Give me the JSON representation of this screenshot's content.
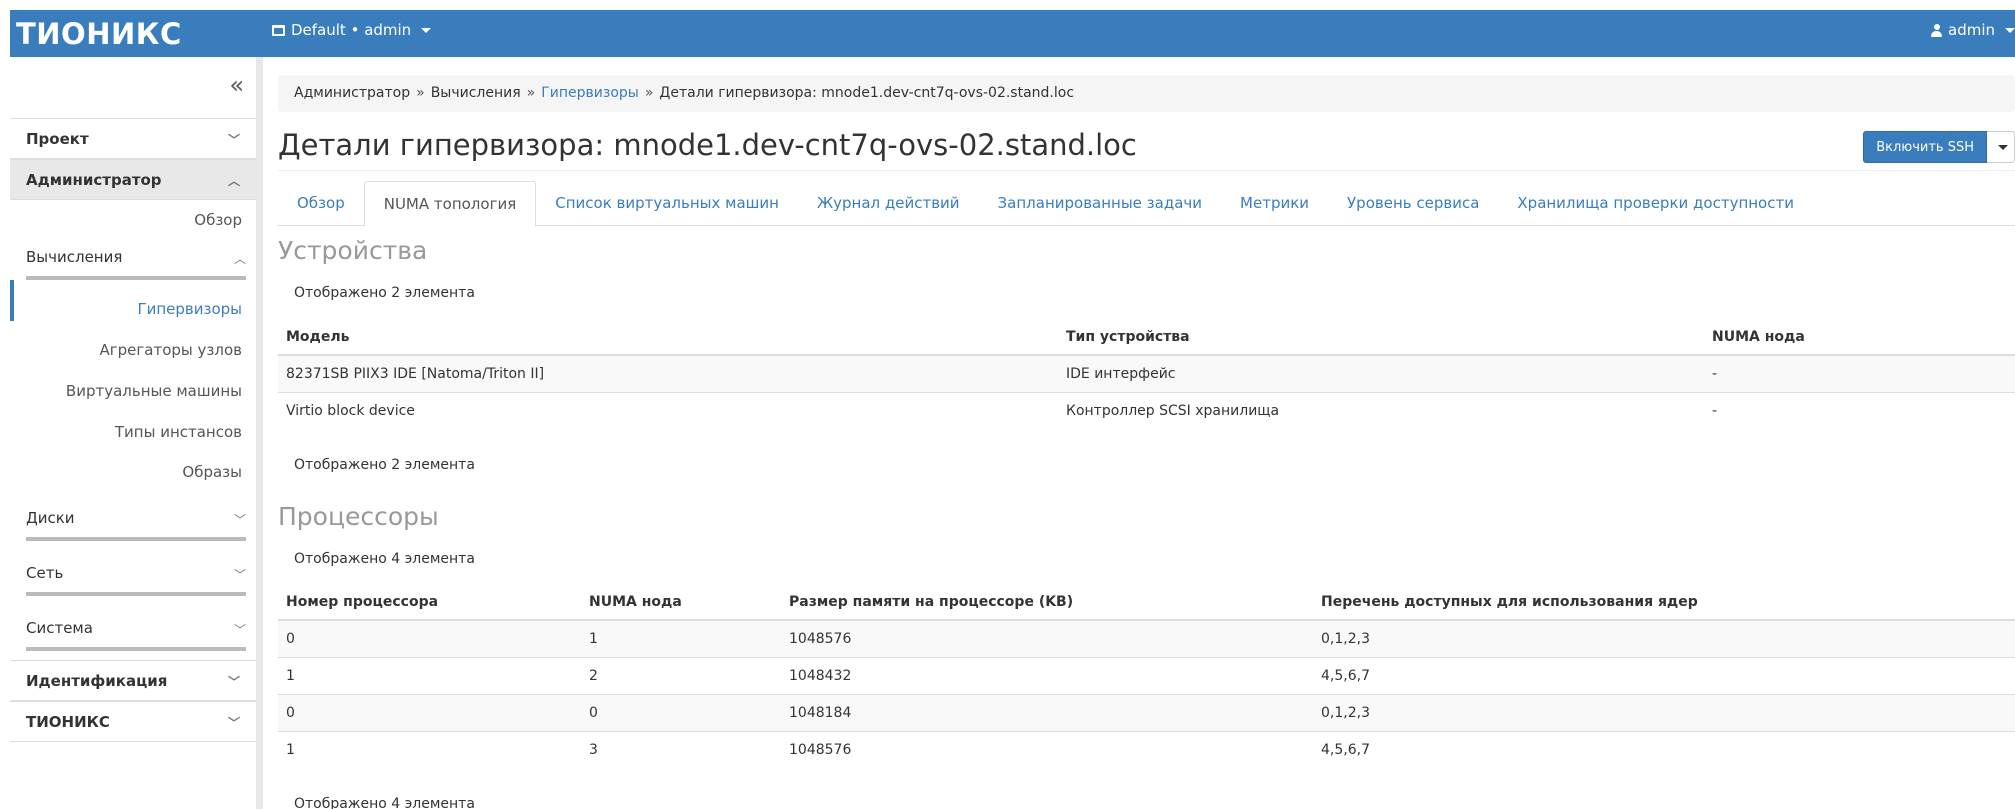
{
  "topbar": {
    "logo": "ТИОНИКС",
    "context": "Default • admin",
    "user": "admin"
  },
  "sidebar": {
    "collapse_glyph": "«",
    "project": "Проект",
    "admin": "Администратор",
    "overview": "Обзор",
    "compute": "Вычисления",
    "compute_items": [
      "Гипервизоры",
      "Агрегаторы узлов",
      "Виртуальные машины",
      "Типы инстансов",
      "Образы"
    ],
    "disks": "Диски",
    "network": "Сеть",
    "system": "Система",
    "identity": "Идентификация",
    "tionix": "ТИОНИКС"
  },
  "breadcrumb": {
    "admin": "Администратор",
    "compute": "Вычисления",
    "hypervisors": "Гипервизоры",
    "current": "Детали гипервизора: mnode1.dev-cnt7q-ovs-02.stand.loc",
    "sep": "»"
  },
  "page": {
    "title": "Детали гипервизора: mnode1.dev-cnt7q-ovs-02.stand.loc",
    "ssh_button": "Включить SSH"
  },
  "tabs": [
    "Обзор",
    "NUMA топология",
    "Список виртуальных машин",
    "Журнал действий",
    "Запланированные задачи",
    "Метрики",
    "Уровень сервиса",
    "Хранилища проверки доступности"
  ],
  "devices": {
    "title": "Устройства",
    "count": "Отображено 2 элемента",
    "headers": [
      "Модель",
      "Тип устройства",
      "NUMA нода"
    ],
    "rows": [
      [
        "82371SB PIIX3 IDE [Natoma/Triton II]",
        "IDE интерфейс",
        "-"
      ],
      [
        "Virtio block device",
        "Контроллер SCSI хранилища",
        "-"
      ]
    ]
  },
  "processors": {
    "title": "Процессоры",
    "count": "Отображено 4 элемента",
    "headers": [
      "Номер процессора",
      "NUMA нода",
      "Размер памяти на процессоре (KB)",
      "Перечень доступных для использования ядер"
    ],
    "rows": [
      [
        "0",
        "1",
        "1048576",
        "0,1,2,3"
      ],
      [
        "1",
        "2",
        "1048432",
        "4,5,6,7"
      ],
      [
        "0",
        "0",
        "1048184",
        "0,1,2,3"
      ],
      [
        "1",
        "3",
        "1048576",
        "4,5,6,7"
      ]
    ]
  },
  "colors": {
    "accent": "#3a7dbd",
    "section_title": "#999999"
  }
}
